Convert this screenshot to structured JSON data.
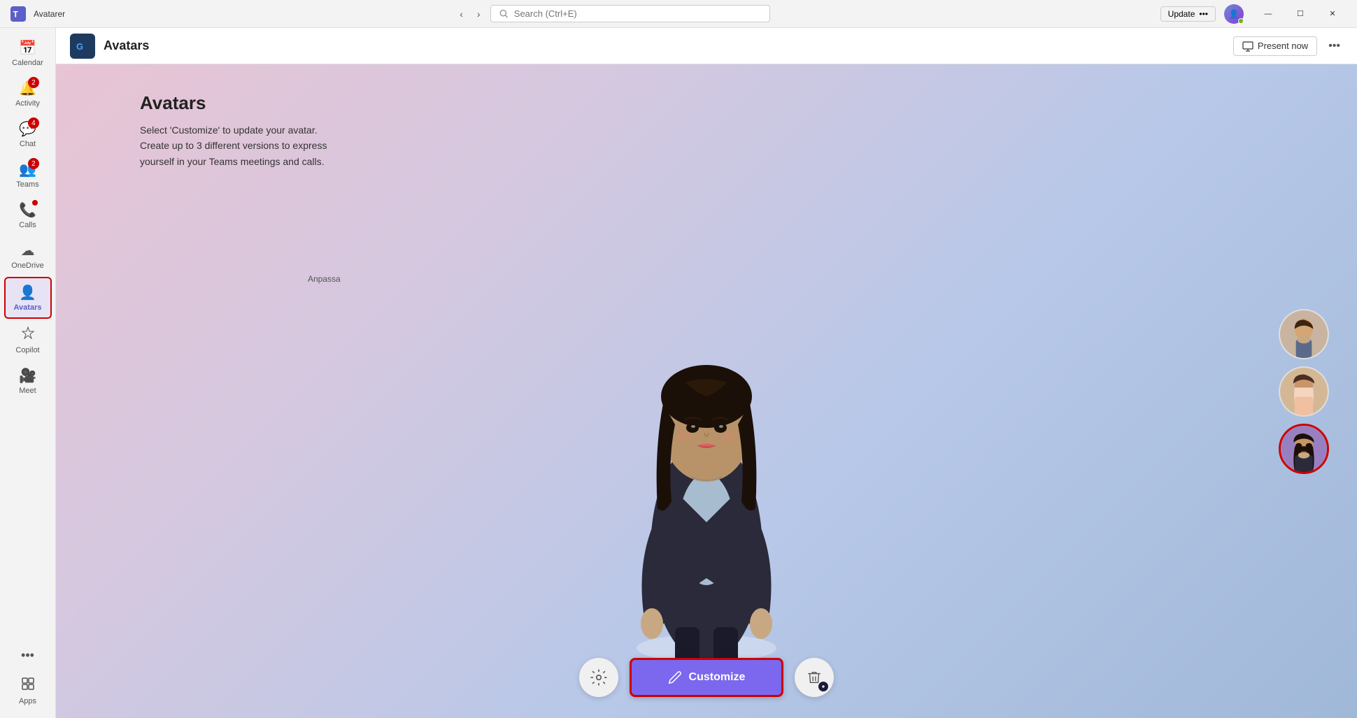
{
  "titlebar": {
    "app_name": "Avatarer",
    "nav_back": "‹",
    "nav_forward": "›",
    "search_placeholder": "Search (Ctrl+E)",
    "update_label": "Update",
    "update_more": "•••",
    "minimize_label": "—",
    "maximize_label": "☐",
    "close_label": "✕"
  },
  "app_header": {
    "title": "Avatars",
    "present_now": "Present now",
    "more": "•••"
  },
  "sidebar": {
    "items": [
      {
        "id": "calendar",
        "label": "Calendar",
        "icon": "📅",
        "badge": null,
        "badge_dot": false
      },
      {
        "id": "activity",
        "label": "Activity",
        "icon": "🔔",
        "badge": "2",
        "badge_dot": false
      },
      {
        "id": "chat",
        "label": "Chat",
        "icon": "💬",
        "badge": "4",
        "badge_dot": false
      },
      {
        "id": "teams",
        "label": "Teams",
        "icon": "👥",
        "badge": "2",
        "badge_dot": false
      },
      {
        "id": "calls",
        "label": "Calls",
        "icon": "📞",
        "badge": null,
        "badge_dot": true
      },
      {
        "id": "onedrive",
        "label": "OneDrive",
        "icon": "☁",
        "badge": null,
        "badge_dot": false
      },
      {
        "id": "avatars",
        "label": "Avatars",
        "icon": "👤",
        "badge": null,
        "badge_dot": false,
        "active": true
      },
      {
        "id": "copilot",
        "label": "Copilot",
        "icon": "⬡",
        "badge": null,
        "badge_dot": false
      },
      {
        "id": "meet",
        "label": "Meet",
        "icon": "🎥",
        "badge": null,
        "badge_dot": false
      }
    ],
    "more_label": "•••",
    "apps_label": "Apps"
  },
  "avatar_page": {
    "title": "Avatars",
    "description_line1": "Select 'Customize' to update your avatar.",
    "description_line2": "Create up to 3 different versions to express",
    "description_line3": "yourself in your Teams meetings and calls.",
    "anpassa_label": "Anpassa",
    "customize_label": "Customize",
    "settings_icon": "⚙",
    "delete_icon": "🗑",
    "pencil_icon": "✏"
  },
  "thumbnails": [
    {
      "id": "thumb-1",
      "active": false,
      "label": "Male avatar"
    },
    {
      "id": "thumb-2",
      "active": false,
      "label": "Female avatar 2"
    },
    {
      "id": "thumb-3",
      "active": true,
      "label": "Female avatar 3 (selected)"
    }
  ]
}
